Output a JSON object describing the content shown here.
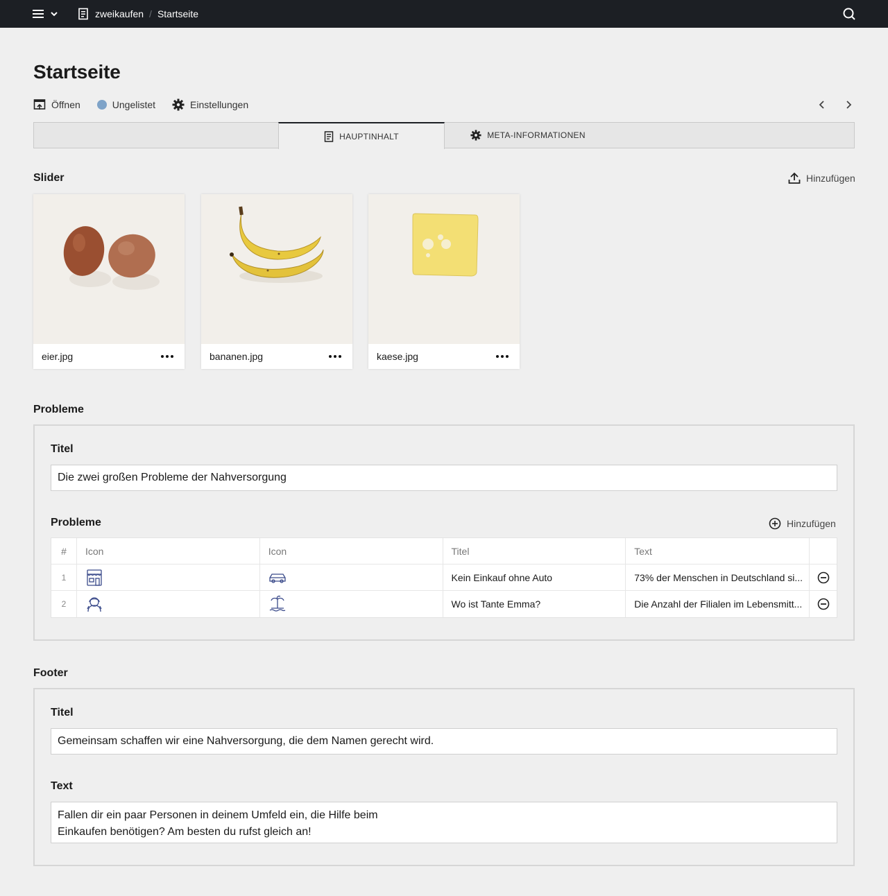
{
  "topbar": {
    "breadcrumbs": [
      "zweikaufen",
      "Startseite"
    ],
    "icons": [
      "menu-icon",
      "chevron-down-icon",
      "document-icon",
      "search-icon"
    ]
  },
  "page": {
    "title": "Startseite"
  },
  "actions": {
    "open_label": "Öffnen",
    "status_label": "Ungelistet",
    "settings_label": "Einstellungen",
    "status_color": "#7ea3c8"
  },
  "tabs": [
    {
      "label": "HAUPTINHALT",
      "active": true
    },
    {
      "label": "META-INFORMATIONEN",
      "active": false
    }
  ],
  "slider": {
    "label": "Slider",
    "add_label": "Hinzufügen",
    "files": [
      {
        "name": "eier.jpg"
      },
      {
        "name": "bananen.jpg"
      },
      {
        "name": "kaese.jpg"
      }
    ]
  },
  "probleme": {
    "label": "Probleme",
    "titel_label": "Titel",
    "titel_value": "Die zwei großen Probleme der Nahversorgung",
    "list_label": "Probleme",
    "add_label": "Hinzufügen",
    "columns": [
      "#",
      "Icon",
      "Icon",
      "Titel",
      "Text"
    ],
    "rows": [
      {
        "num": "1",
        "icon1": "store-icon",
        "icon2": "car-icon",
        "title": "Kein Einkauf ohne Auto",
        "text": "73% der Menschen in Deutschland si..."
      },
      {
        "num": "2",
        "icon1": "person-icon",
        "icon2": "island-icon",
        "title": "Wo ist Tante Emma?",
        "text": "Die Anzahl der Filialen im Lebensmitt..."
      }
    ]
  },
  "footer": {
    "label": "Footer",
    "titel_label": "Titel",
    "titel_value": "Gemeinsam schaffen wir eine Nahversorgung, die dem Namen gerecht wird.",
    "text_label": "Text",
    "text_line1": "Fallen dir ein paar Personen in deinem Umfeld ein, die Hilfe beim",
    "text_line2": "Einkaufen benötigen? Am besten du rufst gleich an!"
  }
}
